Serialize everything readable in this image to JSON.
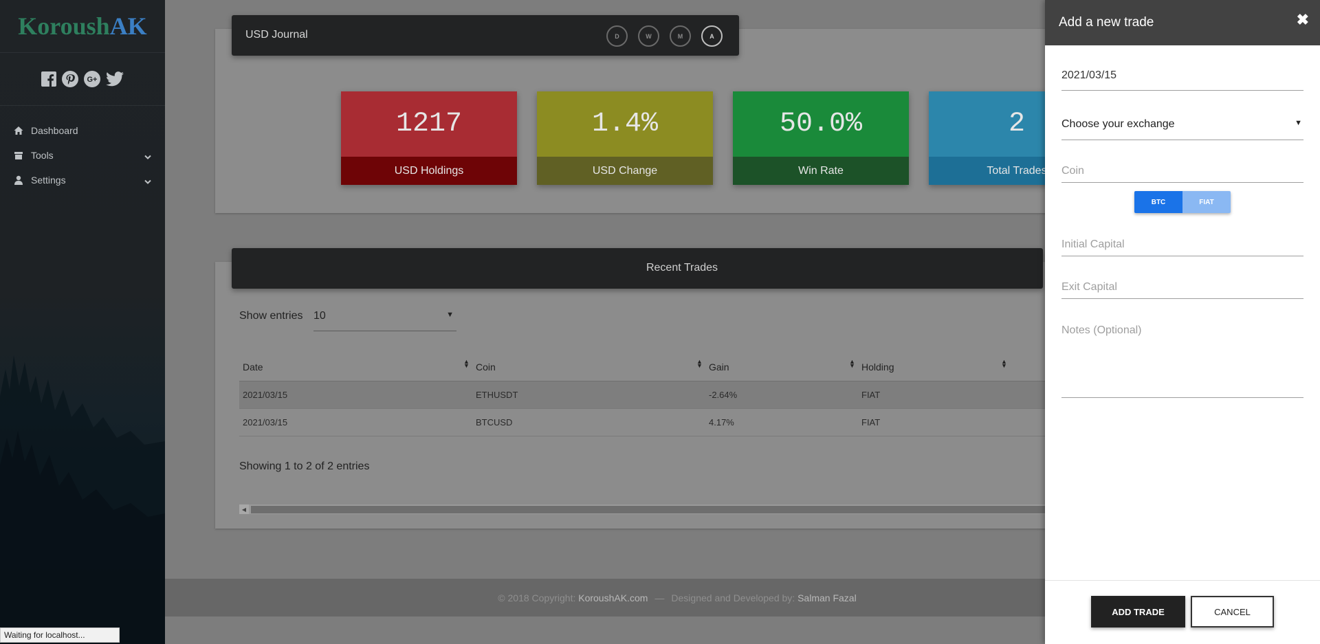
{
  "brand": {
    "name_part1": "Koroush",
    "name_part2": "AK"
  },
  "sidebar": {
    "socials": [
      "facebook-icon",
      "pinterest-icon",
      "google-plus-icon",
      "twitter-icon"
    ],
    "items": [
      {
        "label": "Dashboard",
        "icon": "home-icon"
      },
      {
        "label": "Tools",
        "icon": "archive-icon"
      },
      {
        "label": "Settings",
        "icon": "user-icon"
      }
    ]
  },
  "journal": {
    "title": "USD Journal",
    "periods": [
      "D",
      "W",
      "M",
      "A"
    ],
    "active_period": "A"
  },
  "stats": [
    {
      "value": "1217",
      "label": "USD Holdings",
      "color": "#a82c33"
    },
    {
      "value": "1.4%",
      "label": "USD Change",
      "color": "#8c8c22"
    },
    {
      "value": "50.0%",
      "label": "Win Rate",
      "color": "#1a8a3a"
    },
    {
      "value": "2",
      "label": "Total Trades",
      "color": "#2c86ab"
    }
  ],
  "recent": {
    "title": "Recent Trades",
    "show_entries_label": "Show entries",
    "entries_value": "10",
    "columns": [
      "Date",
      "Coin",
      "Gain",
      "Holding"
    ],
    "rows": [
      [
        "2021/03/15",
        "ETHUSDT",
        "-2.64%",
        "FIAT"
      ],
      [
        "2021/03/15",
        "BTCUSD",
        "4.17%",
        "FIAT"
      ]
    ],
    "showing_text": "Showing 1 to 2 of 2 entries"
  },
  "footer": {
    "copyright": "© 2018 Copyright:",
    "site": "KoroushAK.com",
    "separator": "—",
    "designed": "Designed and Developed by:",
    "author": "Salman Fazal"
  },
  "status_text": "Waiting for localhost...",
  "panel": {
    "title": "Add a new trade",
    "close": "✖",
    "date_value": "2021/03/15",
    "exchange_value": "Choose your exchange",
    "coin_placeholder": "Coin",
    "toggle": [
      "BTC",
      "FIAT"
    ],
    "initial_capital_placeholder": "Initial Capital",
    "exit_capital_placeholder": "Exit Capital",
    "notes_placeholder": "Notes (Optional)",
    "add_label": "ADD TRADE",
    "cancel_label": "CANCEL"
  }
}
